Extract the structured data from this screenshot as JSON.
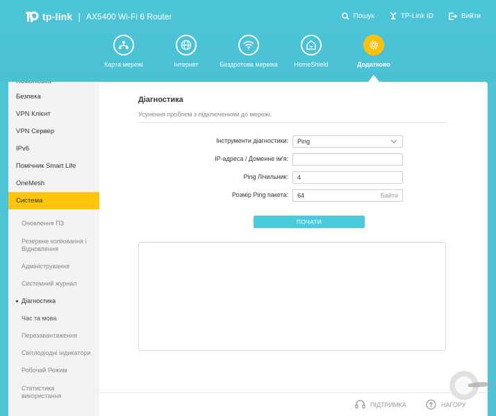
{
  "brand": {
    "logo_text": "tp-link",
    "separator": "|",
    "model": "AX5400 Wi-Fi 6 Router"
  },
  "top_links": {
    "search": "Пошук",
    "tplink_id": "TP-Link ID",
    "logout": "Вийти"
  },
  "nav": [
    {
      "label": "Карта мережі",
      "icon": "network-map-icon"
    },
    {
      "label": "Інтернет",
      "icon": "globe-icon"
    },
    {
      "label": "Бездротова мережа",
      "icon": "wifi-icon"
    },
    {
      "label": "HomeShield",
      "icon": "home-shield-icon"
    },
    {
      "label": "Додатково",
      "icon": "gear-icon",
      "active": true
    }
  ],
  "sidebar": {
    "cut_item": "Номоніська",
    "items": [
      "Безпека",
      "VPN Клієнт",
      "VPN Сервер",
      "IPv6",
      "Помічник Smart Life",
      "OneMesh"
    ],
    "active_item": "Система",
    "sub_items": [
      "Оновлення ПЗ",
      "Резервне копіювання і Відновлення",
      "Адміністрування",
      "Системний журнал",
      "Діагностика",
      "Час та мова",
      "Перезавантаження",
      "Світлодіодні індикатори",
      "Робочий Режим",
      "Статистика використання"
    ]
  },
  "main": {
    "title": "Діагностика",
    "description": "Усунення проблем з підключенням до мережі.",
    "fields": {
      "tool_label": "Інструменти діагностики:",
      "tool_value": "Ping",
      "ip_label": "IP-адреса / Доменне ім'я:",
      "ip_value": "",
      "count_label": "Ping Лічильник:",
      "count_value": "4",
      "size_label": "Розмір Ping пакета:",
      "size_value": "64",
      "size_unit": "Байти"
    },
    "start_button": "ПОЧАТИ"
  },
  "footer": {
    "support": "ПІДТРИМКА",
    "top": "НАГОРУ"
  },
  "colors": {
    "header": "#4cc4d6",
    "accent_yellow": "#ffc40c",
    "button": "#4acbdc"
  }
}
